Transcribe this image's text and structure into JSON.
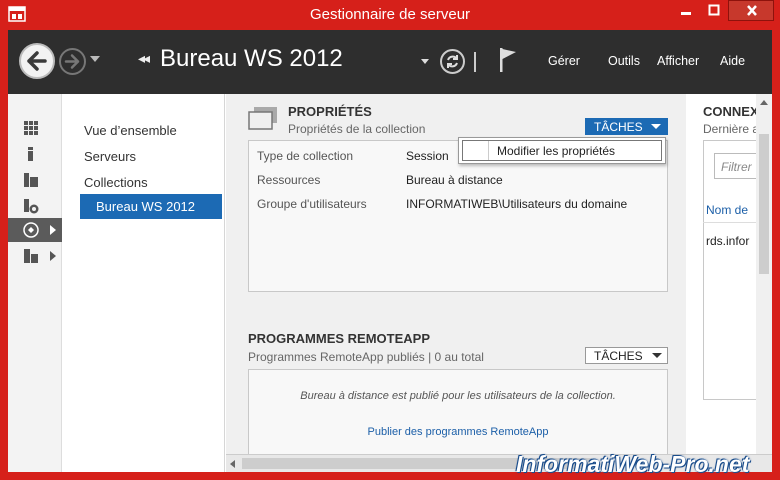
{
  "window": {
    "title": "Gestionnaire de serveur",
    "accent": "#d6201a"
  },
  "header": {
    "breadcrumb_sep": "◂◂",
    "title": "Bureau WS 2012",
    "menu": [
      "Gérer",
      "Outils",
      "Afficher",
      "Aide"
    ]
  },
  "rail": {
    "items": [
      {
        "icon": "dashboard-icon"
      },
      {
        "icon": "local-server-icon"
      },
      {
        "icon": "all-servers-icon"
      },
      {
        "icon": "file-storage-icon"
      },
      {
        "icon": "remote-desktop-icon",
        "active": true
      },
      {
        "icon": "server-group-icon"
      }
    ]
  },
  "subnav": {
    "items": [
      "Vue d’ensemble",
      "Serveurs",
      "Collections"
    ],
    "active": "Bureau WS 2012"
  },
  "properties": {
    "title": "PROPRIÉTÉS",
    "subtitle": "Propriétés de la collection",
    "tasks_label": "TÂCHES",
    "rows": [
      {
        "label": "Type de collection",
        "value": "Session"
      },
      {
        "label": "Ressources",
        "value": "Bureau à distance"
      },
      {
        "label": "Groupe d'utilisateurs",
        "value": "INFORMATIWEB\\Utilisateurs du domaine"
      }
    ]
  },
  "tasks_menu": {
    "items": [
      "Modifier les propriétés"
    ]
  },
  "remoteapp": {
    "title": "PROGRAMMES REMOTEAPP",
    "subtitle": "Programmes RemoteApp publiés | 0 au total",
    "tasks_label": "TÂCHES",
    "info": "Bureau à distance est publié pour les utilisateurs de la collection.",
    "link": "Publier des programmes RemoteApp"
  },
  "connections": {
    "title": "CONNEX",
    "subtitle": "Dernière a",
    "filter_placeholder": "Filtrer",
    "column": "Nom de",
    "row": "rds.infor"
  },
  "watermark": "InformatiWeb-Pro.net"
}
